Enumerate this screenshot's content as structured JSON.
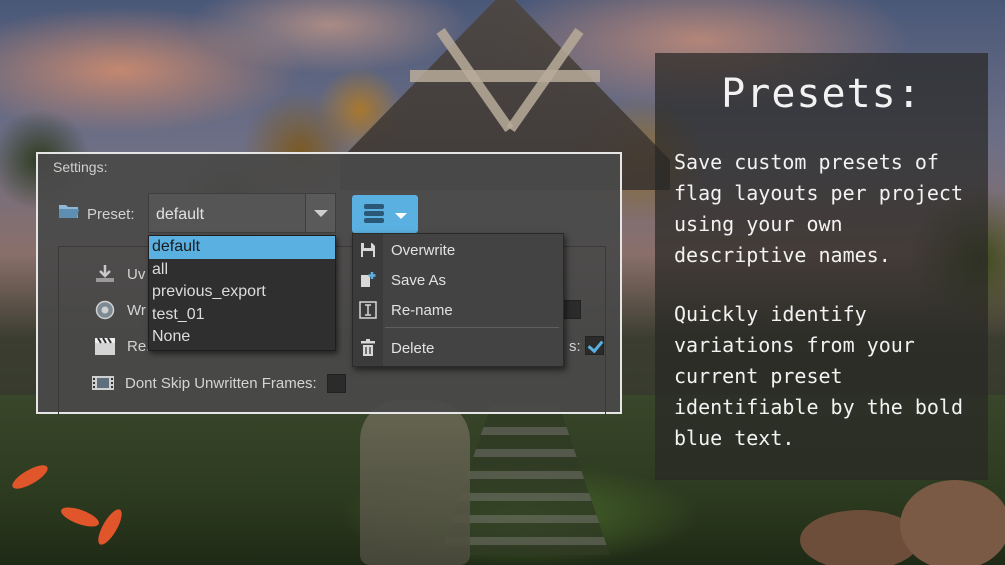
{
  "settings": {
    "title": "Settings:",
    "preset_label": "Preset:",
    "preset_value": "default",
    "preset_options": [
      "default",
      "all",
      "previous_export",
      "test_01",
      "None"
    ],
    "menu": {
      "items": [
        {
          "label": "Overwrite",
          "icon": "floppy-disk-icon"
        },
        {
          "label": "Save As",
          "icon": "add-file-icon"
        },
        {
          "label": "Re-name",
          "icon": "rename-icon"
        },
        {
          "label": "Delete",
          "icon": "trash-icon"
        }
      ]
    },
    "rows": [
      {
        "label": "Uv",
        "icon": "download-arrow-icon",
        "checked": null
      },
      {
        "label": "Wr",
        "icon": "globe-icon",
        "checked": false
      },
      {
        "label": "Re...",
        "icon": "clapperboard-icon",
        "checked": true
      },
      {
        "label": "Dont Skip Unwritten Frames:",
        "icon": "film-strip-icon",
        "checked": false
      }
    ],
    "accent_color": "#5ab0e0"
  },
  "info": {
    "title": "Presets:",
    "paragraph1": "Save custom presets of flag layouts per project using your own descriptive names.",
    "paragraph2": "Quickly identify variations from your current preset identifiable by the bold blue text."
  }
}
